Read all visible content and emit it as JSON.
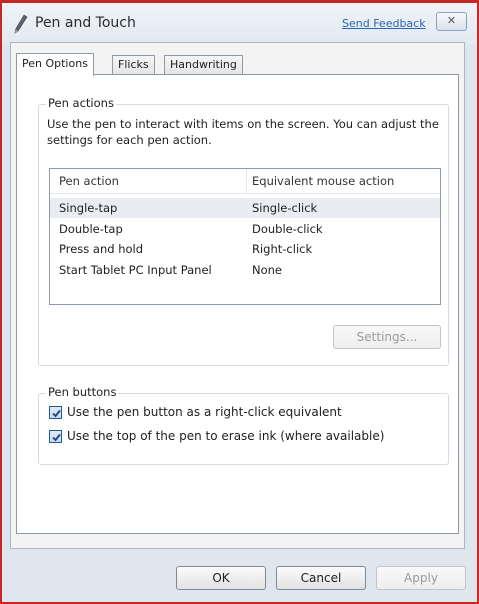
{
  "window": {
    "title": "Pen and Touch",
    "feedback_link": "Send Feedback",
    "close_glyph": "✕",
    "icon": "pen-icon"
  },
  "tabs": [
    {
      "label": "Pen Options",
      "active": true
    },
    {
      "label": "Flicks",
      "active": false
    },
    {
      "label": "Handwriting",
      "active": false
    }
  ],
  "pen_actions": {
    "legend": "Pen actions",
    "description": "Use the pen to interact with items on the screen.  You can adjust the settings for each pen action.",
    "columns": [
      "Pen action",
      "Equivalent mouse action"
    ],
    "rows": [
      {
        "action": "Single-tap",
        "mouse": "Single-click",
        "selected": true
      },
      {
        "action": "Double-tap",
        "mouse": "Double-click",
        "selected": false
      },
      {
        "action": "Press and hold",
        "mouse": "Right-click",
        "selected": false
      },
      {
        "action": "Start Tablet PC Input Panel",
        "mouse": "None",
        "selected": false
      }
    ],
    "settings_button": "Settings..."
  },
  "pen_buttons": {
    "legend": "Pen buttons",
    "options": [
      {
        "label": "Use the pen button as a right-click equivalent",
        "checked": true
      },
      {
        "label": "Use the top of the pen to erase ink (where available)",
        "checked": true
      }
    ]
  },
  "footer": {
    "ok": "OK",
    "cancel": "Cancel",
    "apply": "Apply"
  },
  "colors": {
    "link": "#2a64b6",
    "border_accent": "#c62828",
    "selected_row": "#e9edf2"
  }
}
